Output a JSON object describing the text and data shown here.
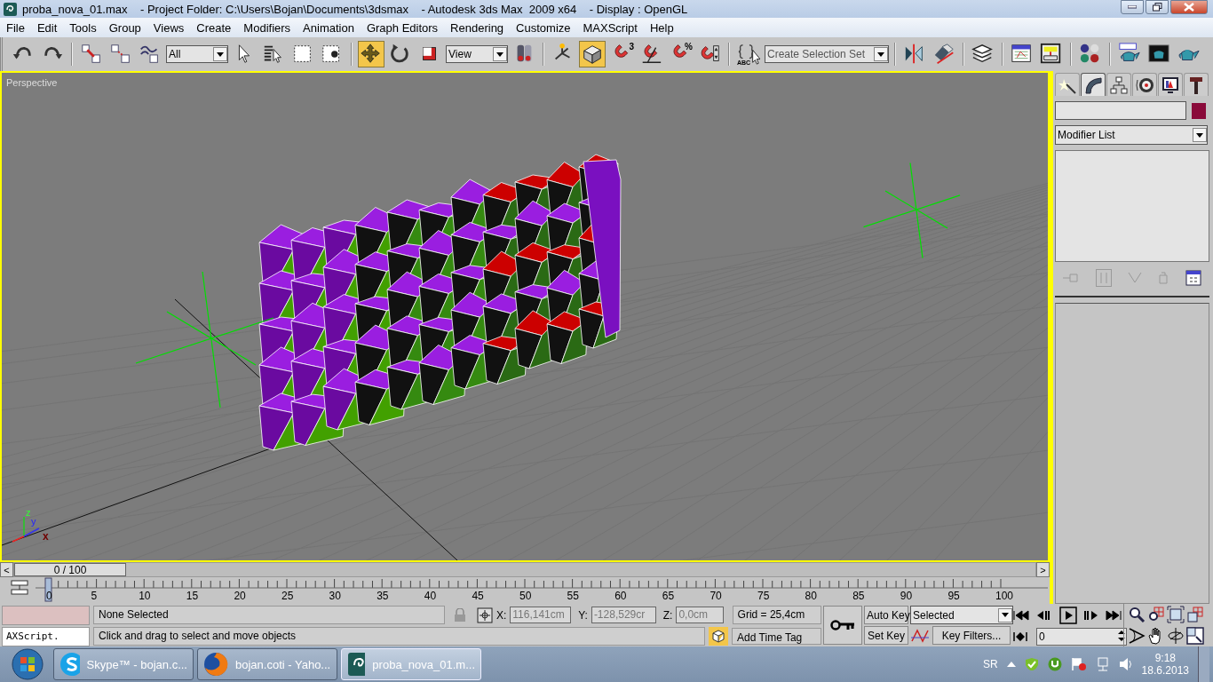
{
  "window": {
    "title": "proba_nova_01.max    - Project Folder: C:\\Users\\Bojan\\Documents\\3dsmax    - Autodesk 3ds Max  2009 x64    - Display : OpenGL"
  },
  "menu": [
    "File",
    "Edit",
    "Tools",
    "Group",
    "Views",
    "Create",
    "Modifiers",
    "Animation",
    "Graph Editors",
    "Rendering",
    "Customize",
    "MAXScript",
    "Help"
  ],
  "toolbar": [
    {
      "kind": "button",
      "selected": false
    },
    {
      "kind": "button",
      "selected": false
    },
    {
      "kind": "separator"
    },
    {
      "kind": "button",
      "selected": false
    },
    {
      "kind": "button",
      "selected": false
    },
    {
      "kind": "button",
      "selected": false
    },
    {
      "kind": "dropdown",
      "value": "All"
    },
    {
      "kind": "button",
      "selected": false
    },
    {
      "kind": "button",
      "selected": false
    },
    {
      "kind": "button",
      "selected": false
    },
    {
      "kind": "button",
      "selected": false
    },
    {
      "kind": "separator"
    },
    {
      "kind": "button",
      "selected": true
    },
    {
      "kind": "button",
      "selected": false
    },
    {
      "kind": "button",
      "selected": false
    },
    {
      "kind": "dropdown",
      "value": "View"
    },
    {
      "kind": "button",
      "selected": false
    },
    {
      "kind": "separator"
    },
    {
      "kind": "button",
      "selected": false
    },
    {
      "kind": "button",
      "selected": true
    },
    {
      "kind": "button",
      "selected": false,
      "badge": "3"
    },
    {
      "kind": "button",
      "selected": false
    },
    {
      "kind": "button",
      "selected": false,
      "badge": "%"
    },
    {
      "kind": "button",
      "selected": false
    },
    {
      "kind": "separator"
    },
    {
      "kind": "button",
      "selected": false,
      "badge": "ABC"
    },
    {
      "kind": "dropdown",
      "value": "Create Selection Set"
    },
    {
      "kind": "separator"
    },
    {
      "kind": "button",
      "selected": false
    },
    {
      "kind": "button",
      "selected": false
    },
    {
      "kind": "separator"
    },
    {
      "kind": "button",
      "selected": false
    },
    {
      "kind": "separator"
    },
    {
      "kind": "button",
      "selected": false
    },
    {
      "kind": "button",
      "selected": false
    },
    {
      "kind": "separator"
    },
    {
      "kind": "button",
      "selected": false
    },
    {
      "kind": "separator"
    },
    {
      "kind": "button",
      "selected": false
    },
    {
      "kind": "button",
      "selected": false
    },
    {
      "kind": "button",
      "selected": false
    }
  ],
  "viewport": {
    "label": "Perspective",
    "axis_labels": [
      "z",
      "y",
      "x"
    ]
  },
  "command_panel": {
    "tabs": [
      {
        "selected": false
      },
      {
        "selected": true
      },
      {
        "selected": false
      },
      {
        "selected": false
      },
      {
        "selected": false
      },
      {
        "selected": false
      }
    ],
    "color": "#8a0a3a",
    "modifier_list": "Modifier List"
  },
  "time_slider": {
    "prev": "<",
    "thumb": "0 / 100",
    "next": ">",
    "level": 0
  },
  "trackbar": {
    "labels": [
      "0",
      "5",
      "10",
      "15",
      "20",
      "25",
      "30",
      "35",
      "40",
      "45",
      "50",
      "55",
      "60",
      "65",
      "70",
      "75",
      "80",
      "85",
      "90",
      "95",
      "100"
    ]
  },
  "status": {
    "listener": "AXScript.",
    "selection": "None Selected",
    "x_label": "X:",
    "x": "116,141cm",
    "y_label": "Y:",
    "y": "-128,529cr",
    "z_label": "Z:",
    "z": "0,0cm",
    "grid": "Grid = 25,4cm",
    "prompt": "Click and drag to select and move objects",
    "time_tag": "Add Time Tag",
    "auto_key": "Auto Key",
    "set_key": "Set Key",
    "key_mode": "Selected",
    "key_filters": "Key Filters...",
    "frame": "0"
  },
  "taskbar": {
    "tasks": [
      {
        "label": "Skype™ - bojan.c...",
        "selected": false
      },
      {
        "label": "bojan.coti - Yaho...",
        "selected": false
      },
      {
        "label": "proba_nova_01.m...",
        "selected": true
      }
    ],
    "language": "SR",
    "time": "9:18",
    "date": "18.6.2013"
  }
}
